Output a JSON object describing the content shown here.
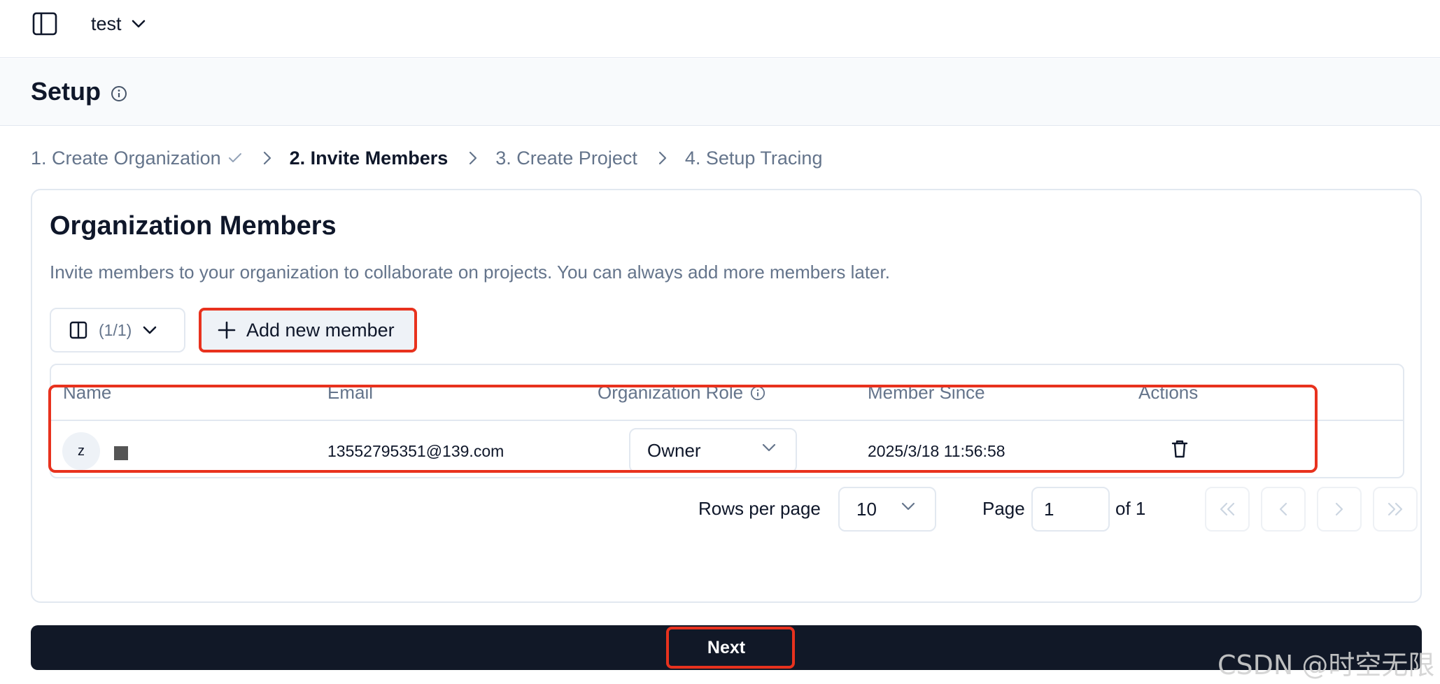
{
  "topbar": {
    "project_name": "test"
  },
  "header": {
    "title": "Setup"
  },
  "stepper": [
    {
      "label": "1. Create Organization",
      "state": "completed"
    },
    {
      "label": "2. Invite Members",
      "state": "active"
    },
    {
      "label": "3. Create Project",
      "state": "pending"
    },
    {
      "label": "4. Setup Tracing",
      "state": "pending"
    }
  ],
  "card": {
    "title": "Organization Members",
    "description": "Invite members to your organization to collaborate on projects. You can always add more members later.",
    "columns_toggle": "(1/1)",
    "add_member_label": "Add new member"
  },
  "table": {
    "headers": {
      "name": "Name",
      "email": "Email",
      "role": "Organization Role",
      "since": "Member Since",
      "actions": "Actions"
    },
    "rows": [
      {
        "avatar_initial": "z",
        "email": "13552795351@139.com",
        "role": "Owner",
        "member_since": "2025/3/18 11:56:58"
      }
    ]
  },
  "pagination": {
    "rows_per_page_label": "Rows per page",
    "rows_per_page": "10",
    "page_label": "Page",
    "current_page": "1",
    "of_label": "of 1"
  },
  "footer": {
    "next_label": "Next"
  },
  "watermark": "CSDN @时空无限",
  "colors": {
    "highlight": "#e8321e",
    "primary_button": "#111827",
    "muted_text": "#64748b"
  }
}
